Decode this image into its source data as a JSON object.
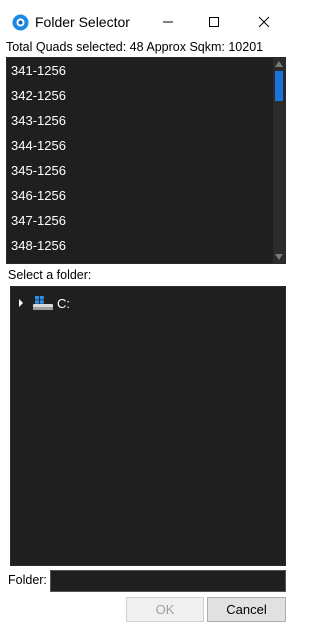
{
  "window": {
    "title": "Folder Selector",
    "icon": "app-icon",
    "controls": {
      "minimize_icon": "minimize-icon",
      "maximize_icon": "maximize-icon",
      "close_icon": "close-icon"
    }
  },
  "summary": "Total Quads selected: 48 Approx Sqkm: 10201",
  "quads": {
    "items": [
      "341-1256",
      "342-1256",
      "343-1256",
      "344-1256",
      "345-1256",
      "346-1256",
      "347-1256",
      "348-1256"
    ]
  },
  "folder_tree": {
    "label": "Select a folder:",
    "root": {
      "label": "C:",
      "icon": "drive-icon",
      "expanded": false
    }
  },
  "folder_field": {
    "label": "Folder:",
    "value": ""
  },
  "buttons": {
    "ok": "OK",
    "cancel": "Cancel"
  },
  "colors": {
    "list_bg": "#1f1f1f",
    "scroll_thumb": "#1a73d9",
    "accent": "#1a73d9"
  }
}
